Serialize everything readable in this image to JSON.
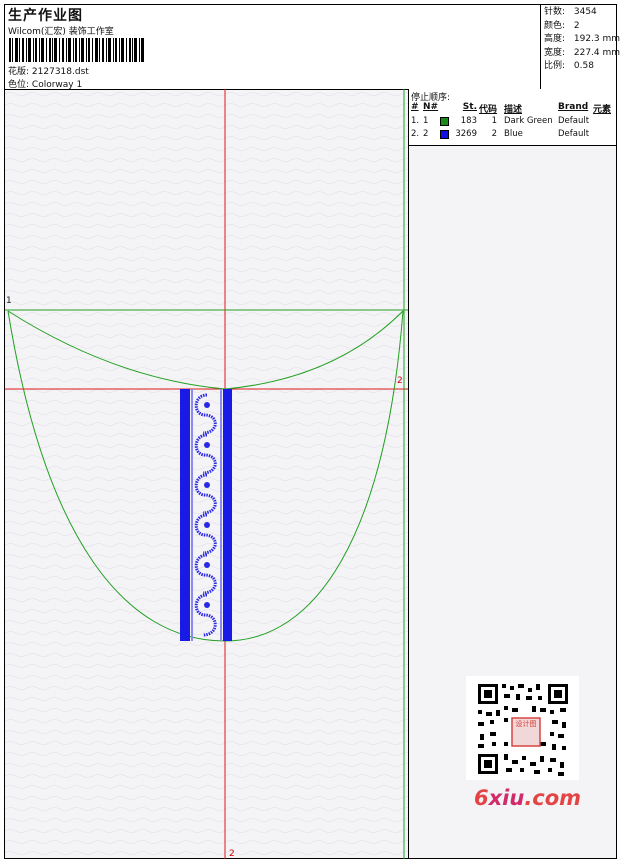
{
  "header": {
    "title": "生产作业图",
    "company": "Wilcom(汇宏) 装饰工作室",
    "pattern_label": "花版:",
    "pattern_value": "2127318.dst",
    "colorway_label": "色位:",
    "colorway_value": "Colorway 1"
  },
  "stats": [
    {
      "label": "针数:",
      "value": "3454"
    },
    {
      "label": "颜色:",
      "value": "2"
    },
    {
      "label": "高度:",
      "value": "192.3 mm"
    },
    {
      "label": "宽度:",
      "value": "227.4 mm"
    },
    {
      "label": "比例:",
      "value": "0.58"
    }
  ],
  "stop_sequence": {
    "title": "停止顺序:",
    "headers": {
      "hash": "#",
      "no": "N#",
      "st": "St.",
      "code": "代码",
      "desc": "描述",
      "brand": "Brand",
      "element": "元素"
    },
    "rows": [
      {
        "hash": "1.",
        "no": "1",
        "color": "#1a8a1a",
        "st": "183",
        "code": "1",
        "desc": "Dark Green",
        "brand": "Default"
      },
      {
        "hash": "2.",
        "no": "2",
        "color": "#1010e0",
        "st": "3269",
        "code": "2",
        "desc": "Blue",
        "brand": "Default"
      }
    ]
  },
  "canvas": {
    "guide_label_1": "1",
    "guide_label_2": "2",
    "guide_label_3": "2",
    "outline_color": "#22a022",
    "guide_color": "#e01818",
    "stitch_color": "#1a1ae6"
  },
  "watermark": {
    "seal_text": "设计图",
    "logo_a": "6",
    "logo_b": "xiu",
    "logo_c": ".com"
  }
}
